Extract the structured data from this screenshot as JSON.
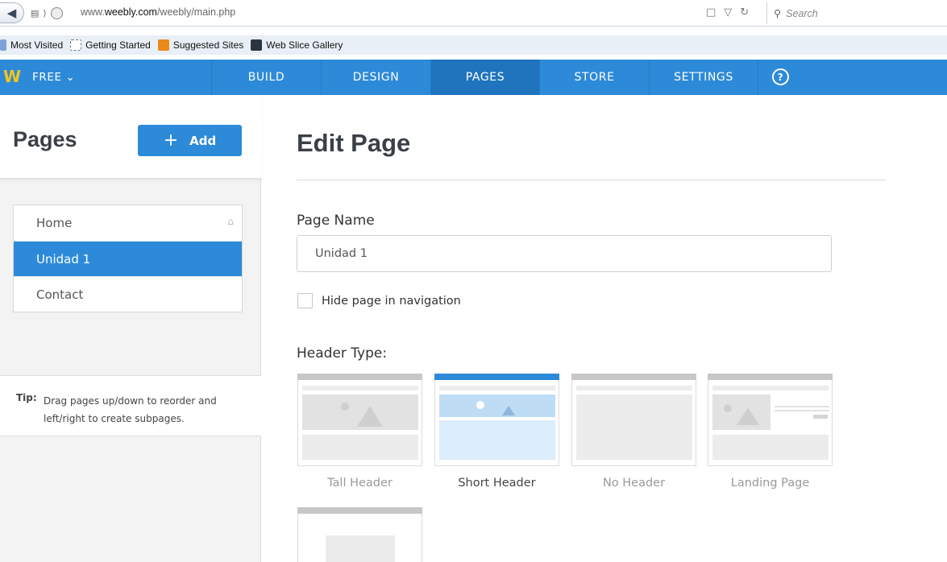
{
  "browser": {
    "url_prefix": "www.",
    "url_domain": "weebly.com",
    "url_path": "/weebly/main.php",
    "search_placeholder": "Search",
    "bookmarks": [
      "Most Visited",
      "Getting Started",
      "Suggested Sites",
      "Web Slice Gallery"
    ]
  },
  "nav": {
    "logo": "W",
    "plan": "FREE ⌄",
    "tabs": [
      "BUILD",
      "DESIGN",
      "PAGES",
      "STORE",
      "SETTINGS"
    ],
    "active_tab": "PAGES",
    "help": "?"
  },
  "sidebar": {
    "title": "Pages",
    "add_button": "Add",
    "pages": [
      "Home",
      "Unidad 1",
      "Contact"
    ],
    "selected_page": "Unidad 1",
    "tip_label": "Tip:",
    "tip_text": "Drag pages up/down to reorder and left/right to create subpages."
  },
  "main": {
    "title": "Edit Page",
    "page_name_label": "Page Name",
    "page_name_value": "Unidad 1",
    "hide_in_nav_label": "Hide page in navigation",
    "hide_in_nav_checked": false,
    "header_type_label": "Header Type:",
    "header_types": [
      "Tall Header",
      "Short Header",
      "No Header",
      "Landing Page"
    ],
    "selected_header": "Short Header"
  },
  "colors": {
    "accent": "#2d8ad8",
    "nav_active": "#1f74bd",
    "logo": "#f4c51c"
  }
}
